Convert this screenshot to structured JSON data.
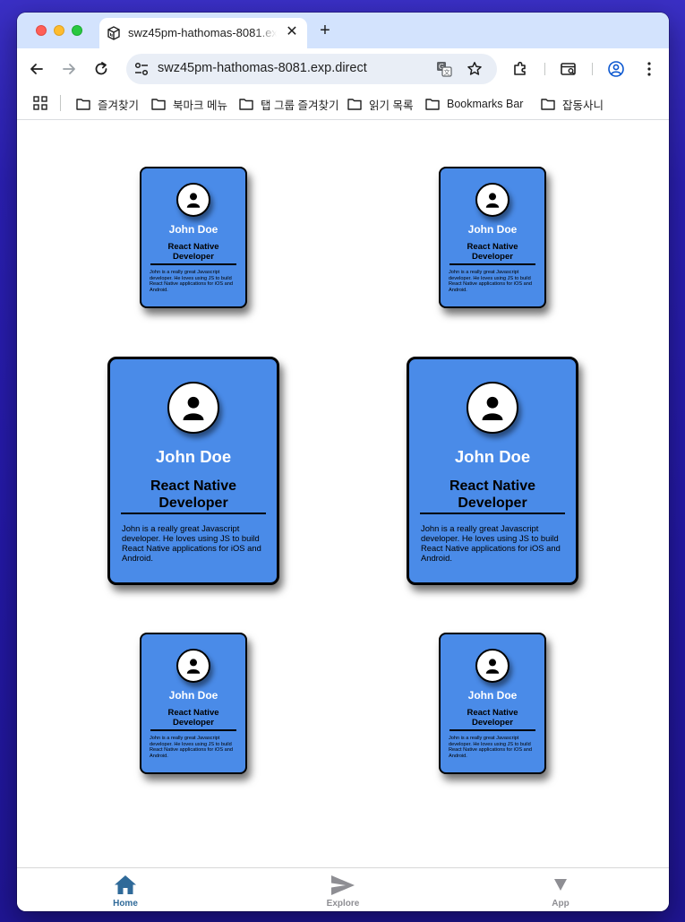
{
  "browser": {
    "tab_title": "swz45pm-hathomas-8081.exp.direct",
    "url": "swz45pm-hathomas-8081.exp.direct"
  },
  "bookmarks": [
    {
      "label": "즐겨찾기"
    },
    {
      "label": "북마크 메뉴"
    },
    {
      "label": "탭 그룹 즐겨찾기"
    },
    {
      "label": "읽기 목록"
    },
    {
      "label": "Bookmarks Bar"
    },
    {
      "label": "잡동사니"
    }
  ],
  "cards": [
    {
      "name": "John Doe",
      "role": "React Native Developer",
      "bio": "John is a really great Javascript developer. He loves using JS to build React Native applications for iOS and Android."
    },
    {
      "name": "John Doe",
      "role": "React Native Developer",
      "bio": "John is a really great Javascript developer. He loves using JS to build React Native applications for iOS and Android."
    },
    {
      "name": "John Doe",
      "role": "React Native Developer",
      "bio": "John is a really great Javascript developer. He loves using JS to build React Native applications for iOS and Android."
    },
    {
      "name": "John Doe",
      "role": "React Native Developer",
      "bio": "John is a really great Javascript developer. He loves using JS to build React Native applications for iOS and Android."
    },
    {
      "name": "John Doe",
      "role": "React Native Developer",
      "bio": "John is a really great Javascript developer. He loves using JS to build React Native applications for iOS and Android."
    },
    {
      "name": "John Doe",
      "role": "React Native Developer",
      "bio": "John is a really great Javascript developer. He loves using JS to build React Native applications for iOS and Android."
    }
  ],
  "bottom_tabs": [
    {
      "label": "Home",
      "icon": "home-icon",
      "active": true
    },
    {
      "label": "Explore",
      "icon": "send-icon",
      "active": false
    },
    {
      "label": "App",
      "icon": "triangle-down-icon",
      "active": false
    }
  ],
  "colors": {
    "card_bg": "#4a8be8",
    "active_tab": "#2f6a99",
    "inactive_tab": "#8e8e93",
    "desktop_bg": "#2a1fb0"
  }
}
